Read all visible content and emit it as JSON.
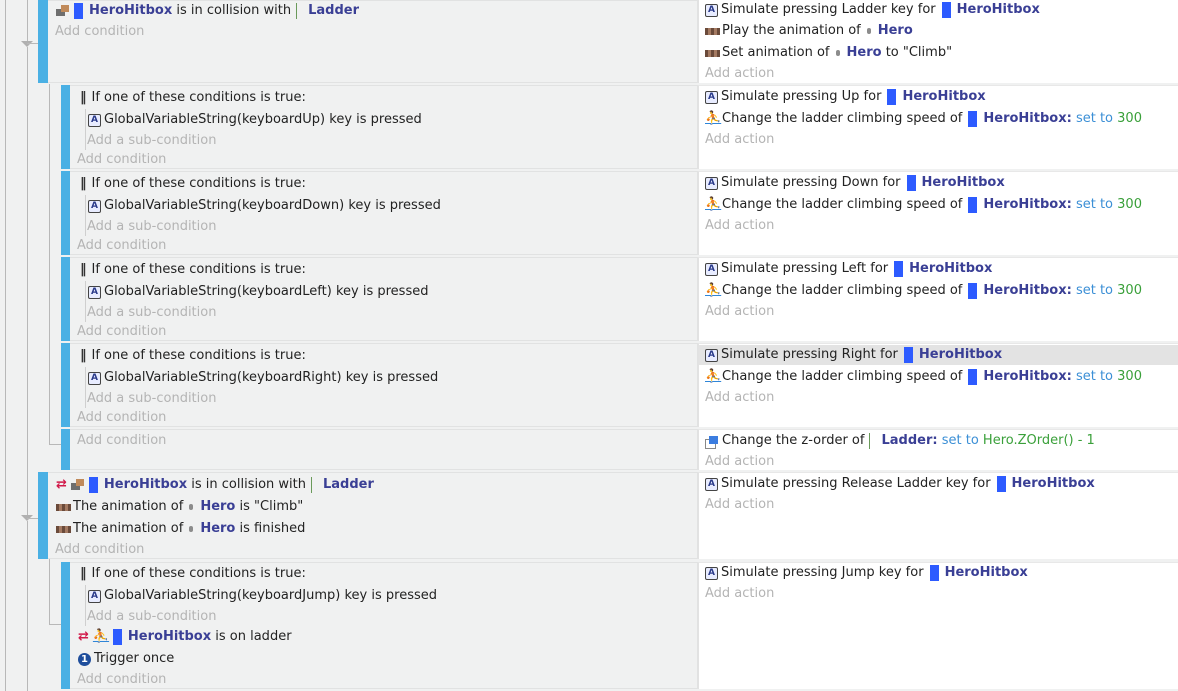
{
  "common": {
    "add_condition": "Add condition",
    "add_action": "Add action",
    "add_sub_condition": "Add a sub-condition",
    "or_header": "If one of these conditions is true:",
    "set_to": "set to",
    "key_is_pressed": "key is pressed"
  },
  "objects": {
    "hitbox": "HeroHitbox",
    "ladder": "Ladder",
    "hero": "Hero"
  },
  "colors": {
    "event_bar": "#4ab0e4",
    "object_name": "#3a3f95",
    "keyword": "#3b8fd6",
    "value": "#3aa03a",
    "invert": "#d11a4a",
    "object_swatch": "#2d5bff"
  },
  "events": [
    {
      "conditions": [
        {
          "icon": "collision-icon",
          "object": "HeroHitbox",
          "text": "is in collision with",
          "target": "Ladder"
        }
      ],
      "actions": [
        {
          "icon": "keyboard-a-icon",
          "prefix": "Simulate pressing Ladder key for",
          "object": "HeroHitbox"
        },
        {
          "icon": "animation-icon",
          "prefix": "Play the animation of",
          "object": "Hero"
        },
        {
          "icon": "animation-icon",
          "prefix": "Set animation of",
          "object": "Hero",
          "suffix": "to \"Climb\""
        }
      ]
    },
    {
      "sub": true,
      "or_condition": "GlobalVariableString(keyboardUp)",
      "actions": [
        {
          "prefix": "Simulate pressing Up for",
          "object": "HeroHitbox"
        },
        {
          "prefix": "Change the ladder climbing speed of",
          "object": "HeroHitbox",
          "op": "set to",
          "value": "300"
        }
      ]
    },
    {
      "sub": true,
      "or_condition": "GlobalVariableString(keyboardDown)",
      "actions": [
        {
          "prefix": "Simulate pressing Down for",
          "object": "HeroHitbox"
        },
        {
          "prefix": "Change the ladder climbing speed of",
          "object": "HeroHitbox",
          "op": "set to",
          "value": "300"
        }
      ]
    },
    {
      "sub": true,
      "or_condition": "GlobalVariableString(keyboardLeft)",
      "actions": [
        {
          "prefix": "Simulate pressing Left for",
          "object": "HeroHitbox"
        },
        {
          "prefix": "Change the ladder climbing speed of",
          "object": "HeroHitbox",
          "op": "set to",
          "value": "300"
        }
      ]
    },
    {
      "sub": true,
      "or_condition": "GlobalVariableString(keyboardRight)",
      "actions": [
        {
          "prefix": "Simulate pressing Right for",
          "object": "HeroHitbox",
          "highlighted": true
        },
        {
          "prefix": "Change the ladder climbing speed of",
          "object": "HeroHitbox",
          "op": "set to",
          "value": "300"
        }
      ]
    },
    {
      "sub": true,
      "actions": [
        {
          "prefix": "Change the z-order of",
          "object": "Ladder",
          "op": "set to",
          "value": "Hero.ZOrder() - 1"
        }
      ]
    },
    {
      "conditions": [
        {
          "inverted": true,
          "object": "HeroHitbox",
          "text": "is in collision with",
          "target": "Ladder"
        },
        {
          "prefix": "The animation of",
          "object": "Hero",
          "text": "is \"Climb\""
        },
        {
          "prefix": "The animation of",
          "object": "Hero",
          "text": "is finished"
        }
      ],
      "actions": [
        {
          "prefix": "Simulate pressing Release Ladder key for",
          "object": "HeroHitbox"
        }
      ]
    },
    {
      "sub": true,
      "or_condition": "GlobalVariableString(keyboardJump)",
      "conditions": [
        {
          "inverted": true,
          "object": "HeroHitbox",
          "text": "is on ladder"
        },
        {
          "text": "Trigger once"
        }
      ],
      "actions": [
        {
          "prefix": "Simulate pressing Jump key for",
          "object": "HeroHitbox"
        }
      ]
    }
  ]
}
